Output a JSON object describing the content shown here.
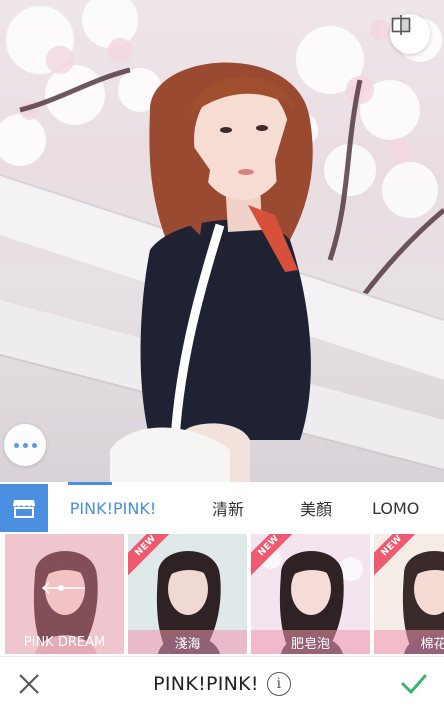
{
  "photo": {
    "compare_icon": "compare-split-icon",
    "more_icon": "more-dots-icon"
  },
  "tabs": {
    "store_icon": "store-icon",
    "items": [
      "PINK!PINK!",
      "清新",
      "美顏",
      "LOMO"
    ],
    "active_index": 0
  },
  "filters": [
    {
      "label": "PINK DREAM",
      "badge": "",
      "selected": true
    },
    {
      "label": "淺海",
      "badge": "NEW",
      "selected": false
    },
    {
      "label": "肥皂泡",
      "badge": "NEW",
      "selected": false
    },
    {
      "label": "棉花",
      "badge": "NEW",
      "selected": false
    }
  ],
  "bottom": {
    "title": "PINK!PINK!",
    "info_glyph": "i",
    "cancel_icon": "close-icon",
    "apply_icon": "checkmark-icon"
  },
  "colors": {
    "accent": "#4a8fe0",
    "badge": "#f05a6e",
    "apply": "#3cb371",
    "label_bar": "#f096af"
  }
}
